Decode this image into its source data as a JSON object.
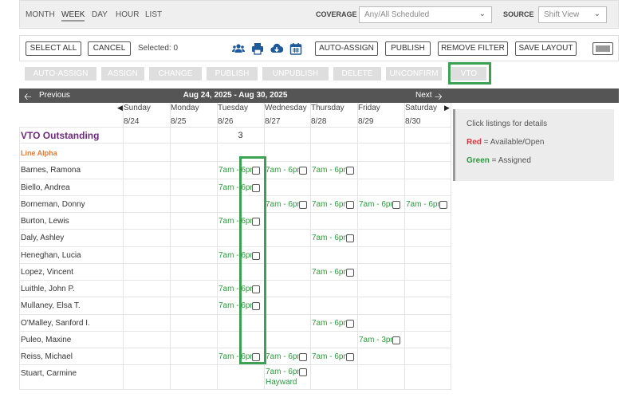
{
  "view_tabs": [
    "MONTH",
    "WEEK",
    "DAY",
    "HOUR",
    "LIST"
  ],
  "filters": {
    "coverage_label": "COVERAGE",
    "coverage_value": "Any/All Scheduled",
    "source_label": "SOURCE",
    "source_value": "Shift View"
  },
  "toolbar": {
    "select_all": "SELECT ALL",
    "cancel": "CANCEL",
    "selected": "Selected: 0",
    "auto_assign": "AUTO-ASSIGN",
    "publish": "PUBLISH",
    "remove_filter": "REMOVE FILTER",
    "save_layout": "SAVE LAYOUT"
  },
  "actions": [
    "AUTO-ASSIGN",
    "ASSIGN",
    "CHANGE",
    "PUBLISH",
    "UNPUBLISH",
    "DELETE",
    "UNCONFIRM",
    "VTO"
  ],
  "nav": {
    "previous": "Previous",
    "range": "Aug 24, 2025 - Aug 30, 2025",
    "next": "Next"
  },
  "days": [
    {
      "name": "Sunday",
      "date": "8/24"
    },
    {
      "name": "Monday",
      "date": "8/25"
    },
    {
      "name": "Tuesday",
      "date": "8/26"
    },
    {
      "name": "Wednesday",
      "date": "8/27"
    },
    {
      "name": "Thursday",
      "date": "8/28"
    },
    {
      "name": "Friday",
      "date": "8/29"
    },
    {
      "name": "Saturday",
      "date": "8/30"
    }
  ],
  "vto_outstanding": {
    "label": "VTO Outstanding",
    "count": "3"
  },
  "group": "Line Alpha",
  "shift_label": "7am - 6pm",
  "shift_label_short": "7am - 3pm",
  "employees": [
    {
      "name": "Barnes, Ramona",
      "shifts": [
        2,
        3,
        4
      ]
    },
    {
      "name": "Biello, Andrea",
      "shifts": [
        2
      ]
    },
    {
      "name": "Borneman, Donny",
      "shifts": [
        3,
        4,
        5,
        6
      ]
    },
    {
      "name": "Burton, Lewis",
      "shifts": [
        2
      ]
    },
    {
      "name": "Daly, Ashley",
      "shifts": [
        4
      ]
    },
    {
      "name": "Heneghan, Lucia",
      "shifts": [
        2
      ]
    },
    {
      "name": "Lopez, Vincent",
      "shifts": [
        4
      ]
    },
    {
      "name": "Luithle, John P.",
      "shifts": [
        2
      ]
    },
    {
      "name": "Mullaney, Elsa T.",
      "shifts": [
        2
      ]
    },
    {
      "name": "O'Malley, Sanford I.",
      "shifts": [
        4
      ]
    },
    {
      "name": "Puleo, Maxine",
      "shifts": [
        5
      ],
      "short": true
    },
    {
      "name": "Reiss, Michael",
      "shifts": [
        2,
        3,
        4
      ]
    },
    {
      "name": "Stuart, Carmine",
      "shifts": [
        3
      ],
      "sublabel": "Hayward"
    }
  ],
  "legend": {
    "header": "Click listings for details",
    "red_word": "Red",
    "red_text": " = Available/Open",
    "green_word": "Green",
    "green_text": " = Assigned"
  },
  "icons": [
    "people-icon",
    "print-icon",
    "cloud-download-icon",
    "calendar-icon",
    "arrow-left-icon",
    "arrow-right-icon",
    "chevron-down-icon"
  ],
  "colors": {
    "accent_green": "#3ba153",
    "shift_green": "#2a9a3a",
    "vto_purple": "#6b2a7a",
    "group_orange": "#e07b3d",
    "red": "#d43a3a"
  }
}
